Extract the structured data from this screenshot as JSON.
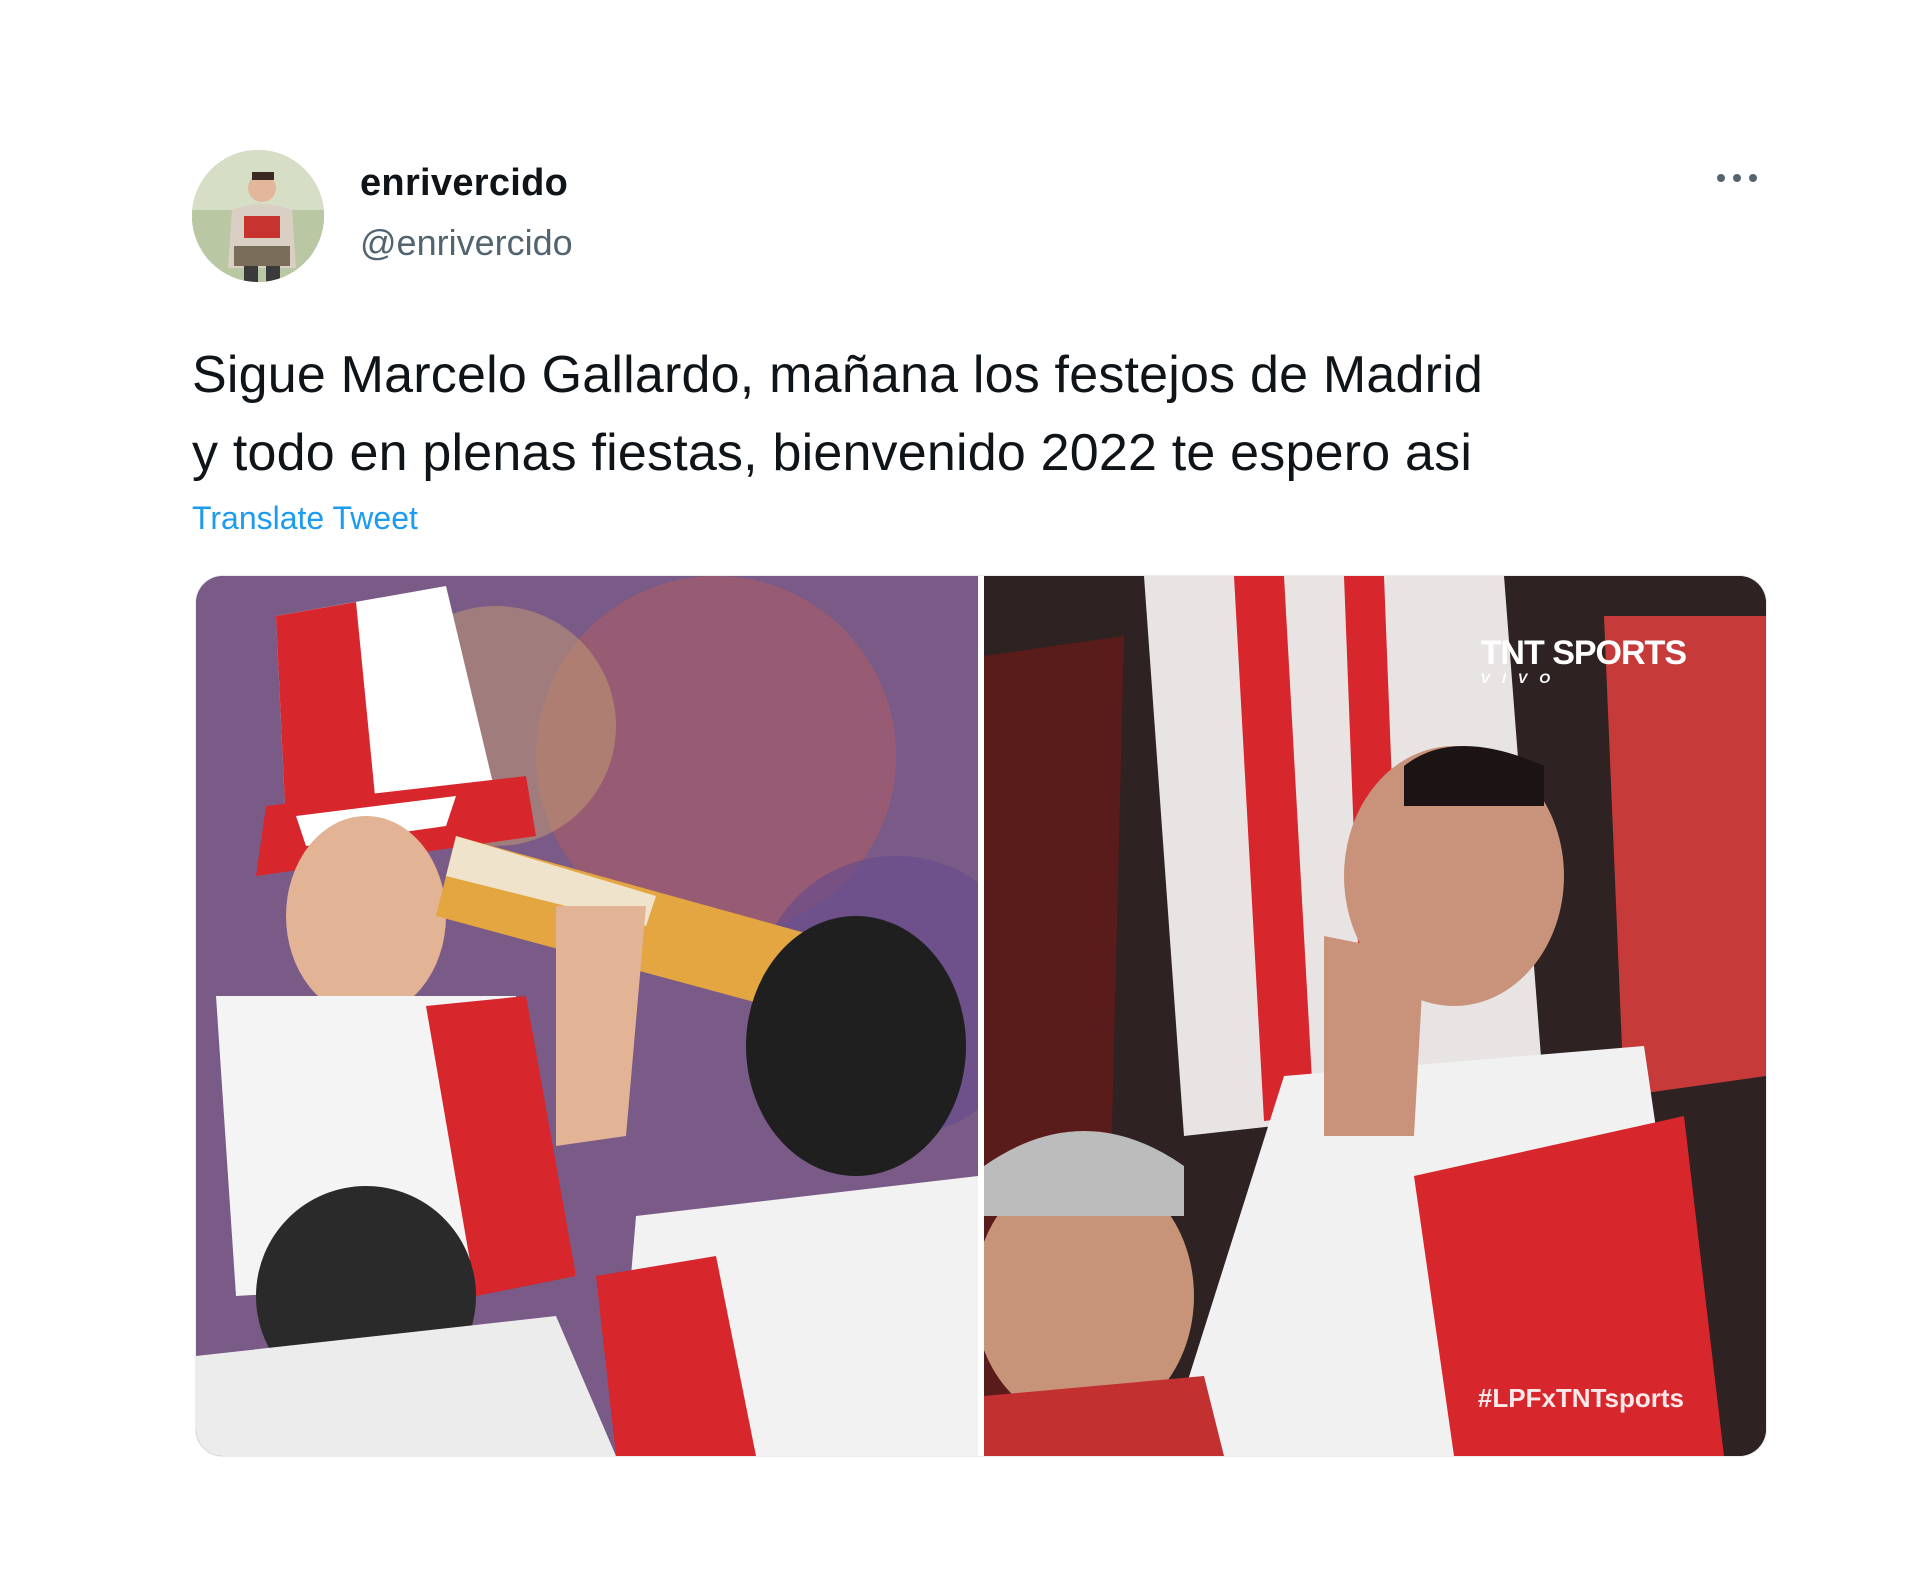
{
  "tweet": {
    "display_name": "enrivercido",
    "handle": "@enrivercido",
    "text_lines": [
      "Sigue Marcelo Gallardo, mañana los festejos de Madrid",
      "y todo en plenas fiestas, bienvenido 2022 te espero asi"
    ],
    "translate_label": "Translate Tweet",
    "more_icon": "more-horizontal-icon"
  },
  "media": {
    "right_watermark_brand": "TNT SPORTS",
    "right_watermark_sub": "VIVO",
    "right_hashtag": "#LPFxTNTsports"
  }
}
